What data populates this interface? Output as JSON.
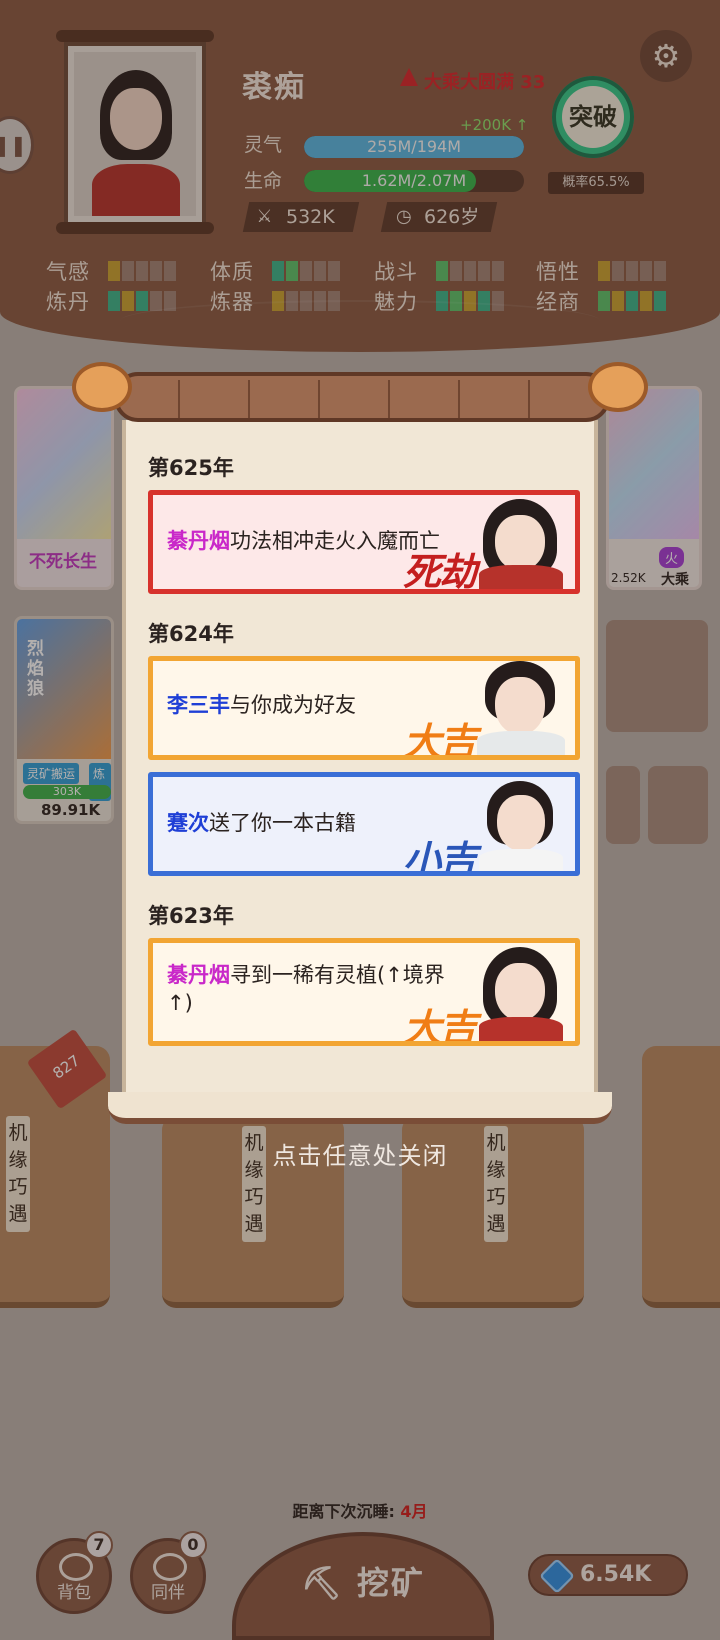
{
  "player": {
    "name": "裘痴",
    "realm": "大乘大圆满 33",
    "qi_label": "灵气",
    "qi_value": "255M/194M",
    "qi_gain": "+200K ↑",
    "life_label": "生命",
    "life_value": "1.62M/2.07M",
    "life_fraction": 0.78,
    "power": "532K",
    "age": "626岁",
    "breakthrough_label": "突破",
    "breakthrough_rate": "概率65.5%"
  },
  "attributes": [
    {
      "name": "气感",
      "level": 1
    },
    {
      "name": "体质",
      "level": 2
    },
    {
      "name": "战斗",
      "level": 1
    },
    {
      "name": "悟性",
      "level": 1
    },
    {
      "name": "炼丹",
      "level": 3
    },
    {
      "name": "炼器",
      "level": 1
    },
    {
      "name": "魅力",
      "level": 4
    },
    {
      "name": "经商",
      "level": 5
    }
  ],
  "background": {
    "card1_label": "不死长生",
    "card2_title": "烈焰狼",
    "card2_tag1": "灵矿搬运",
    "card2_tag2": "炼丹",
    "card2_value": "303K",
    "card2_power": "89.91K",
    "card3_tag": "火",
    "card3_value": "2.52K",
    "card3_realm": "大乘",
    "sack_label": "机缘巧遇",
    "sack_count": "827"
  },
  "events_log": {
    "years": [
      "第625年",
      "第624年",
      "第623年"
    ],
    "events": [
      {
        "name": "綦丹烟",
        "text": "功法相冲走火入魔而亡",
        "stamp": "死劫",
        "name_color": "#c928c9"
      },
      {
        "name": "李三丰",
        "text": "与你成为好友",
        "stamp": "大吉",
        "name_color": "#1f3fd6"
      },
      {
        "name": "蹇次",
        "text": "送了你一本古籍",
        "stamp": "小吉",
        "name_color": "#1f3fd6"
      },
      {
        "name": "綦丹烟",
        "text": "寻到一稀有灵植(↑境界↑)",
        "stamp": "大吉",
        "name_color": "#c928c9"
      }
    ],
    "close_hint": "点击任意处关闭"
  },
  "footer": {
    "sleep_text": "距离下次沉睡:",
    "sleep_value": "4月",
    "bag_label": "背包",
    "bag_badge": "7",
    "partner_label": "同伴",
    "partner_badge": "0",
    "mine_label": "挖矿",
    "gems": "6.54K"
  },
  "colors": {
    "header": "#8a5a43",
    "qi_bar": "#58b7e4",
    "life_bar": "#37b44a",
    "death_border": "#d7322c",
    "fortune_border": "#f2a533",
    "luck_border": "#3a6ed6"
  }
}
